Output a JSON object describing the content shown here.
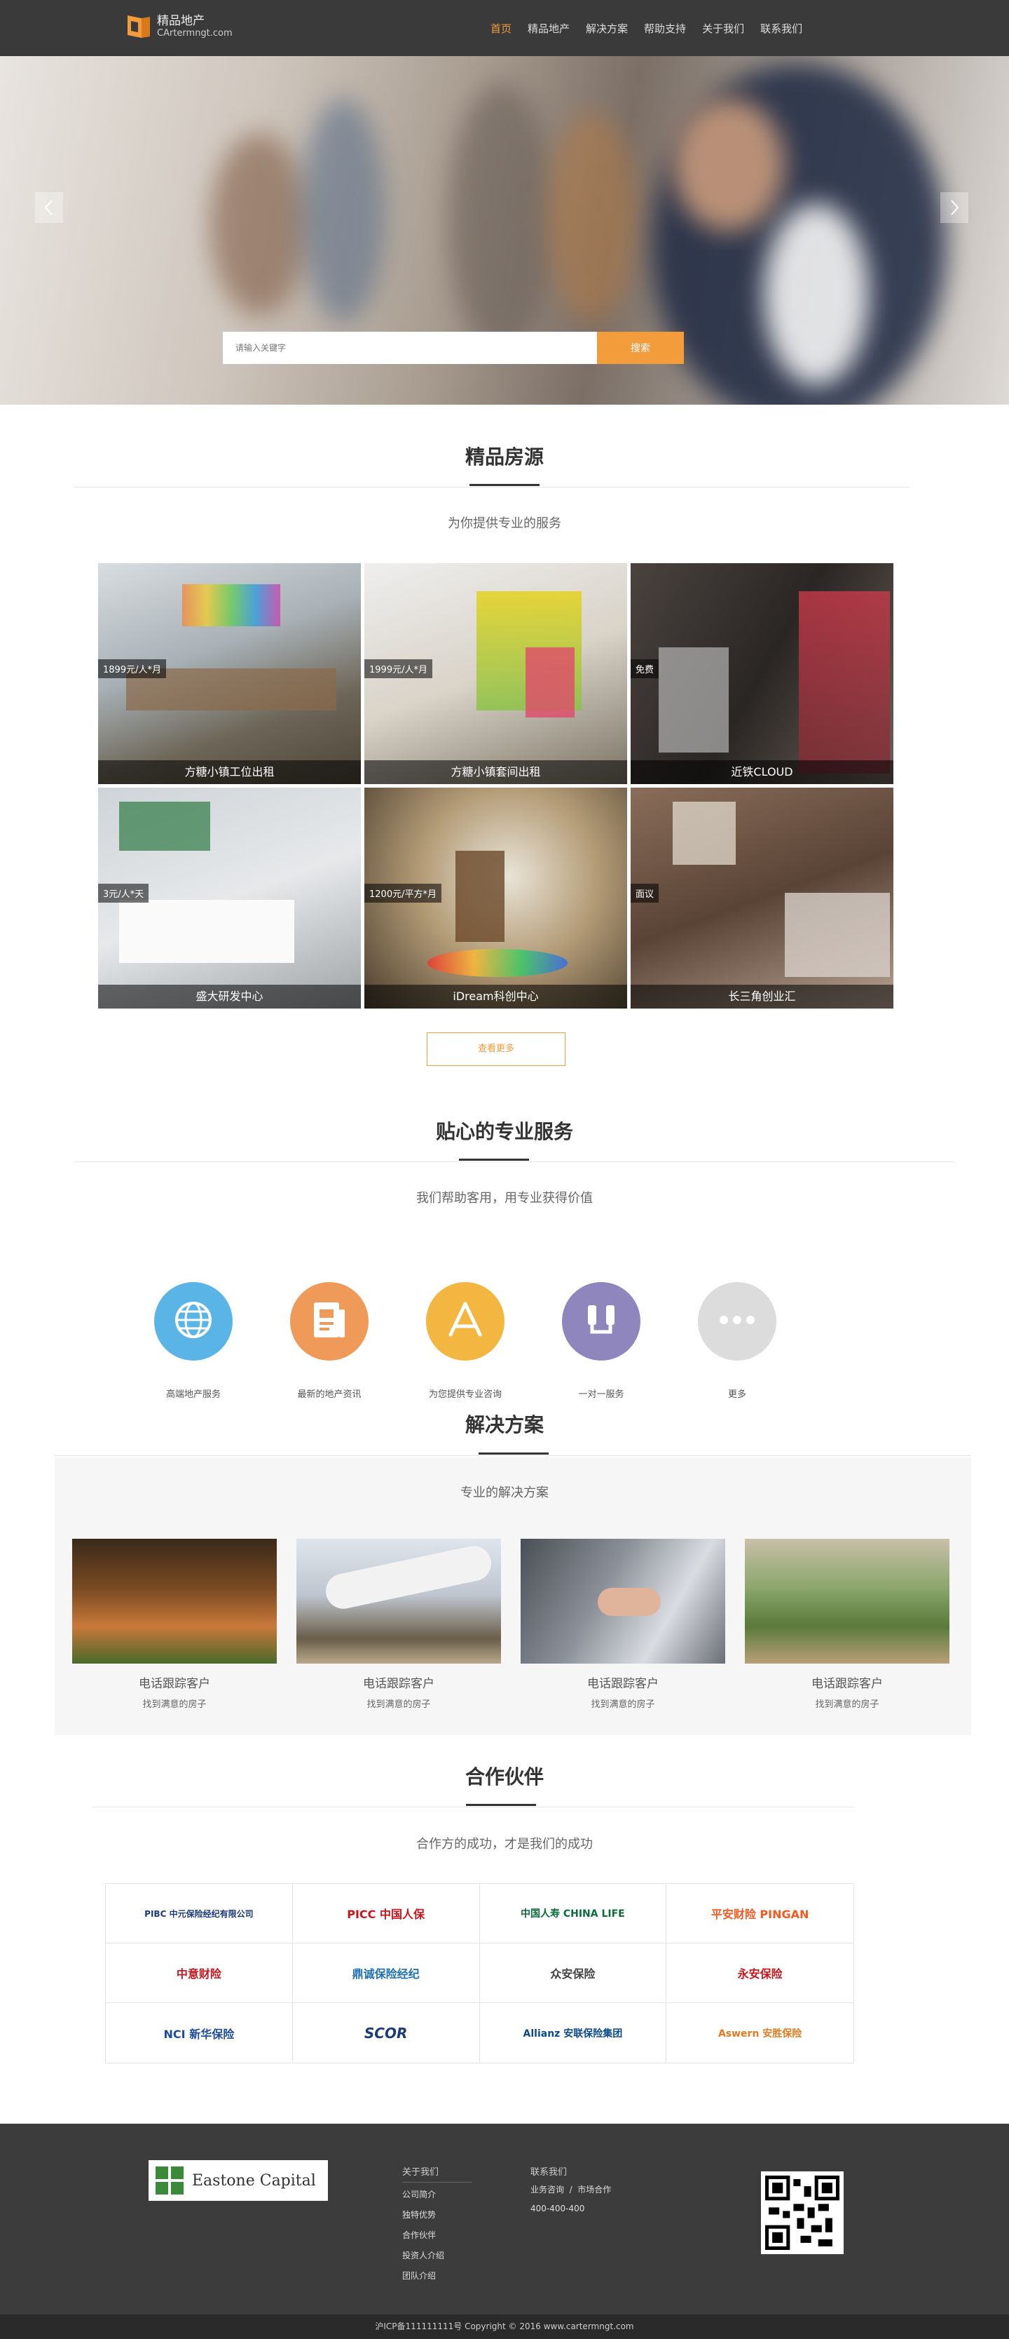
{
  "header": {
    "logo_title": "精品地产",
    "logo_sub": "CArtermngt.com",
    "nav": [
      "首页",
      "精品地产",
      "解决方案",
      "帮助支持",
      "关于我们",
      "联系我们"
    ],
    "accent": "#f39c3c"
  },
  "hero": {
    "search_placeholder": "请输入关键字",
    "search_button": "搜索"
  },
  "featured": {
    "title": "精品房源",
    "subtitle": "为你提供专业的服务",
    "items": [
      {
        "price": "1899元/人*月",
        "name": "方糖小镇工位出租"
      },
      {
        "price": "1999元/人*月",
        "name": "方糖小镇套间出租"
      },
      {
        "price": "免费",
        "name": "近铁CLOUD"
      },
      {
        "price": "3元/人*天",
        "name": "盛大研发中心"
      },
      {
        "price": "1200元/平方*月",
        "name": "iDream科创中心"
      },
      {
        "price": "面议",
        "name": "长三角创业汇"
      }
    ],
    "more_button": "查看更多"
  },
  "services": {
    "title": "贴心的专业服务",
    "subtitle": "我们帮助客用，用专业获得价值",
    "items": [
      {
        "label": "高端地产服务",
        "icon": "globe-icon",
        "color": "#5ab4e5"
      },
      {
        "label": "最新的地产资讯",
        "icon": "document-icon",
        "color": "#f09a5a"
      },
      {
        "label": "为您提供专业咨询",
        "icon": "app-store-icon",
        "color": "#f3b640"
      },
      {
        "label": "一对一服务",
        "icon": "people-icon",
        "color": "#8f86bd"
      },
      {
        "label": "更多",
        "icon": "more-icon",
        "color": "#dcdcdc"
      }
    ]
  },
  "solutions": {
    "title": "解决方案",
    "subtitle": "专业的解决方案",
    "items": [
      {
        "title": "电话跟踪客户",
        "sub": "找到满意的房子"
      },
      {
        "title": "电话跟踪客户",
        "sub": "找到满意的房子"
      },
      {
        "title": "电话跟踪客户",
        "sub": "找到满意的房子"
      },
      {
        "title": "电话跟踪客户",
        "sub": "找到满意的房子"
      }
    ]
  },
  "partners": {
    "title": "合作伙伴",
    "subtitle": "合作方的成功，才是我们的成功",
    "logos": [
      {
        "text": "PIBC 中元保险经纪有限公司",
        "color": "#1d3a7a"
      },
      {
        "text": "PICC 中国人保",
        "color": "#c8161d"
      },
      {
        "text": "中国人寿 CHINA LIFE",
        "color": "#0c6b3b"
      },
      {
        "text": "平安财险 PINGAN",
        "color": "#f15a22"
      },
      {
        "text": "中意财险",
        "color": "#c8161d"
      },
      {
        "text": "鼎诚保险经纪",
        "color": "#1d6fb5"
      },
      {
        "text": "众安保险",
        "color": "#444444"
      },
      {
        "text": "永安保险",
        "color": "#c8161d"
      },
      {
        "text": "NCI 新华保险",
        "color": "#1d4d9a"
      },
      {
        "text": "SCOR",
        "color": "#1d3a7a"
      },
      {
        "text": "Allianz 安联保险集团",
        "color": "#0b4a8a"
      },
      {
        "text": "Aswern 安胜保险",
        "color": "#e37a1f"
      }
    ]
  },
  "footer": {
    "brand": "Eastone Capital",
    "about_title": "关于我们",
    "about_links": [
      "公司简介",
      "独特优势",
      "合作伙伴",
      "投资人介绍",
      "团队介绍"
    ],
    "contact_title": "联系我们",
    "contact_links": "业务咨询  /  市场合作",
    "phone": "400-400-400",
    "copyright": "沪ICP备111111111号 Copyright © 2016 www.cartermngt.com"
  }
}
